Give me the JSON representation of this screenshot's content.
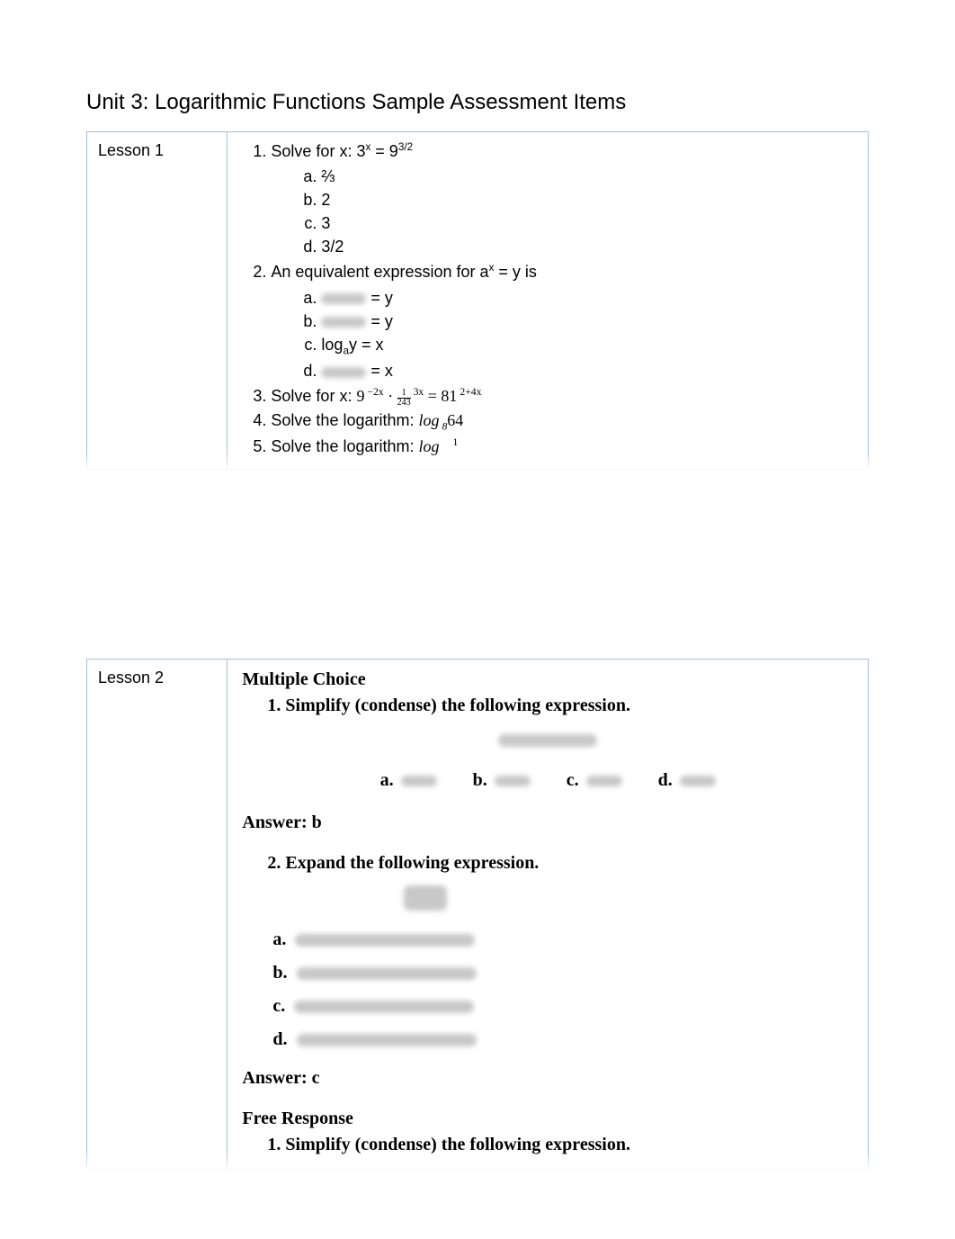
{
  "title": "Unit 3: Logarithmic Functions Sample Assessment Items",
  "lesson1": {
    "label": "Lesson 1",
    "q1": {
      "stem_pre": "Solve for x: 3",
      "stem_mid": " = 9",
      "a": "⅔",
      "b": "2",
      "c": "3",
      "d": "3/2"
    },
    "q2": {
      "stem_pre": "An equivalent expression for a",
      "stem_post": " = y is",
      "opt_a_tail": " = y",
      "opt_b_tail": " = y",
      "opt_c": "log",
      "opt_c_mid": "y = x",
      "opt_d_tail": " = x"
    },
    "q3": {
      "stem_pre": "Solve for x: ",
      "nine": "9",
      "exp1": " −2x",
      "dot": " · ",
      "exp2": " 3x",
      "eq": " = 81",
      "exp3": " 2+4x"
    },
    "q4": {
      "stem_pre": "Solve the logarithm: ",
      "log": "log",
      "sub": " 8",
      "arg": "64"
    },
    "q5": {
      "stem_pre": "Solve the logarithm: ",
      "log": "log",
      "tail": "1"
    }
  },
  "lesson2": {
    "label": "Lesson 2",
    "mc_title": "Multiple Choice",
    "q1": "Simplify (condense) the following expression.",
    "choices": {
      "a": "a.",
      "b": "b.",
      "c": "c.",
      "d": "d."
    },
    "ans1": "Answer: b",
    "q2": "Expand the following expression.",
    "ans2": "Answer: c",
    "fr_title": "Free Response",
    "fr_q1": "Simplify (condense) the following expression."
  }
}
